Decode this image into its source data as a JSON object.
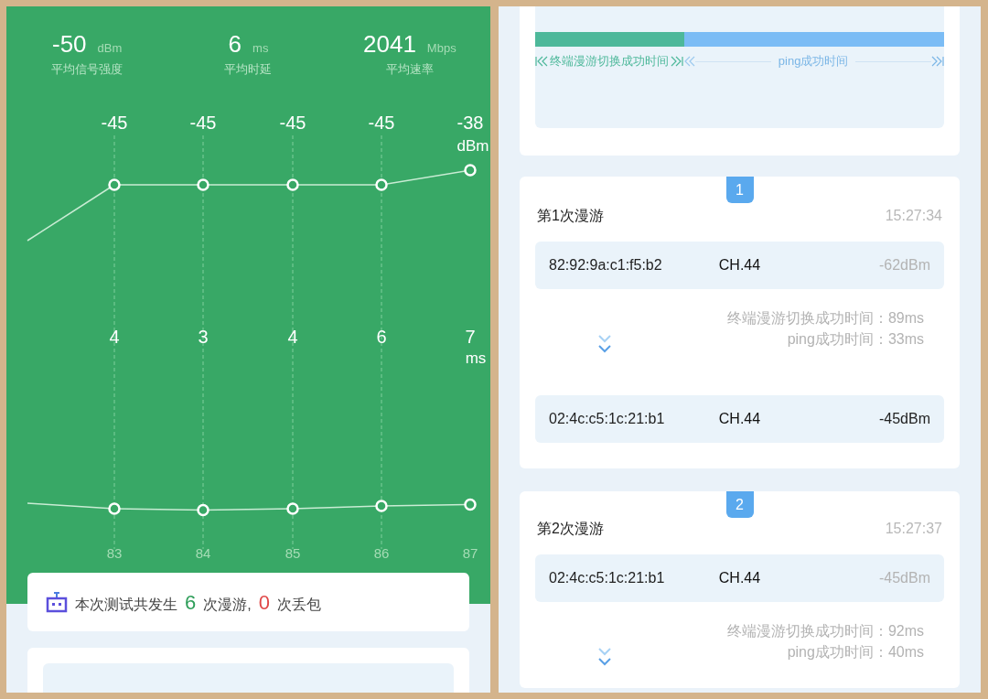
{
  "left_screen": {
    "stats": [
      {
        "value": "-50",
        "unit": "dBm",
        "label": "平均信号强度"
      },
      {
        "value": "6",
        "unit": "ms",
        "label": "平均时延"
      },
      {
        "value": "2041",
        "unit": "Mbps",
        "label": "平均速率"
      }
    ],
    "signal_chart": {
      "unit": "dBm",
      "point_labels": [
        "-45",
        "-45",
        "-45",
        "-45",
        "-38"
      ]
    },
    "latency_chart": {
      "unit": "ms",
      "point_labels": [
        "4",
        "3",
        "4",
        "6",
        "7"
      ],
      "x_labels": [
        "83",
        "84",
        "85",
        "86",
        "87"
      ]
    },
    "summary": {
      "prefix": "本次测试共发生",
      "roam_count": "6",
      "middle": "次漫游,",
      "loss_count": "0",
      "suffix": "次丢包"
    }
  },
  "right_screen": {
    "timeline": {
      "level": 0.365,
      "handoff_label": "终端漫游切换成功时间",
      "ping_label": "ping成功时间"
    },
    "roams": [
      {
        "badge": "1",
        "title": "第1次漫游",
        "time": "15:27:34",
        "rows": [
          {
            "mac": "82:92:9a:c1:f5:b2",
            "channel": "CH.44",
            "signal": "-62dBm",
            "kind": "source"
          },
          {
            "mac": "02:4c:c5:1c:21:b1",
            "channel": "CH.44",
            "signal": "-45dBm",
            "kind": "target"
          }
        ],
        "handoff_label": "终端漫游切换成功时间：",
        "handoff_value": "89ms",
        "ping_label": "ping成功时间：",
        "ping_value": "33ms"
      },
      {
        "badge": "2",
        "title": "第2次漫游",
        "time": "15:27:37",
        "rows": [
          {
            "mac": "02:4c:c5:1c:21:b1",
            "channel": "CH.44",
            "signal": "-45dBm",
            "kind": "source"
          }
        ],
        "handoff_label": "终端漫游切换成功时间：",
        "handoff_value": "92ms",
        "ping_label": "ping成功时间：",
        "ping_value": "40ms"
      }
    ]
  }
}
